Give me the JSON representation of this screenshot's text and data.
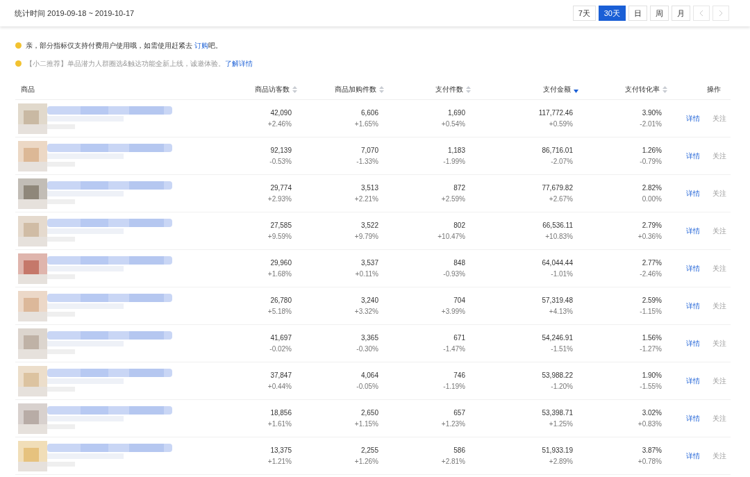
{
  "header": {
    "period": "统计时间 2019-09-18 ~ 2019-10-17",
    "ranges": [
      {
        "label": "7天",
        "selected": false
      },
      {
        "label": "30天",
        "selected": true
      },
      {
        "label": "日",
        "selected": false
      },
      {
        "label": "周",
        "selected": false
      },
      {
        "label": "月",
        "selected": false
      }
    ]
  },
  "notices": [
    {
      "text": "亲，部分指标仅支持付费用户使用哦，如需使用赶紧去 ",
      "link": "订购",
      "after": "吧。",
      "muted": false
    },
    {
      "text": "【小二推荐】单品潜力人群圈选&触达功能全新上线，诚邀体验。",
      "link": "了解详情",
      "muted": true
    }
  ],
  "table": {
    "columns": [
      {
        "label": "商品",
        "sortable": false
      },
      {
        "label": "商品访客数",
        "sortable": true,
        "sorted": false
      },
      {
        "label": "商品加购件数",
        "sortable": true,
        "sorted": false
      },
      {
        "label": "支付件数",
        "sortable": true,
        "sorted": false
      },
      {
        "label": "支付金额",
        "sortable": true,
        "sorted": true
      },
      {
        "label": "支付转化率",
        "sortable": true,
        "sorted": false
      },
      {
        "label": "操作",
        "sortable": false
      }
    ],
    "rows": [
      {
        "cells": [
          {
            "kind": "picture"
          },
          {
            "kind": "metric",
            "value": "42,090",
            "change": "+2.46%"
          },
          {
            "kind": "metric",
            "value": "6,606",
            "change": "+1.65%"
          },
          {
            "kind": "metric",
            "value": "1,690",
            "change": "+0.54%"
          },
          {
            "kind": "metric",
            "value": "117,772.46",
            "change": "+0.59%"
          },
          {
            "kind": "metric",
            "value": "3.90%",
            "change": "-2.01%"
          },
          {
            "kind": "actions",
            "links": [
              "详情",
              "关注"
            ]
          }
        ]
      },
      {
        "cells": [
          {
            "kind": "picture"
          },
          {
            "kind": "metric",
            "value": "92,139",
            "change": "-0.53%"
          },
          {
            "kind": "metric",
            "value": "7,070",
            "change": "-1.33%"
          },
          {
            "kind": "metric",
            "value": "1,183",
            "change": "-1.99%"
          },
          {
            "kind": "metric",
            "value": "86,716.01",
            "change": "-2.07%"
          },
          {
            "kind": "metric",
            "value": "1.26%",
            "change": "-0.79%"
          },
          {
            "kind": "actions",
            "links": [
              "详情",
              "关注"
            ]
          }
        ]
      },
      {
        "cells": [
          {
            "kind": "picture"
          },
          {
            "kind": "metric",
            "value": "29,774",
            "change": "+2.93%"
          },
          {
            "kind": "metric",
            "value": "3,513",
            "change": "+2.21%"
          },
          {
            "kind": "metric",
            "value": "872",
            "change": "+2.59%"
          },
          {
            "kind": "metric",
            "value": "77,679.82",
            "change": "+2.67%"
          },
          {
            "kind": "metric",
            "value": "2.82%",
            "change": "0.00%"
          },
          {
            "kind": "actions",
            "links": [
              "详情",
              "关注"
            ]
          }
        ]
      },
      {
        "cells": [
          {
            "kind": "picture"
          },
          {
            "kind": "metric",
            "value": "27,585",
            "change": "+9.59%"
          },
          {
            "kind": "metric",
            "value": "3,522",
            "change": "+9.79%"
          },
          {
            "kind": "metric",
            "value": "802",
            "change": "+10.47%"
          },
          {
            "kind": "metric",
            "value": "66,536.11",
            "change": "+10.83%"
          },
          {
            "kind": "metric",
            "value": "2.79%",
            "change": "+0.36%"
          },
          {
            "kind": "actions",
            "links": [
              "详情",
              "关注"
            ]
          }
        ]
      },
      {
        "cells": [
          {
            "kind": "picture"
          },
          {
            "kind": "metric",
            "value": "29,960",
            "change": "+1.68%"
          },
          {
            "kind": "metric",
            "value": "3,537",
            "change": "+0.11%"
          },
          {
            "kind": "metric",
            "value": "848",
            "change": "-0.93%"
          },
          {
            "kind": "metric",
            "value": "64,044.44",
            "change": "-1.01%"
          },
          {
            "kind": "metric",
            "value": "2.77%",
            "change": "-2.46%"
          },
          {
            "kind": "actions",
            "links": [
              "详情",
              "关注"
            ]
          }
        ]
      },
      {
        "cells": [
          {
            "kind": "picture"
          },
          {
            "kind": "metric",
            "value": "26,780",
            "change": "+5.18%"
          },
          {
            "kind": "metric",
            "value": "3,240",
            "change": "+3.32%"
          },
          {
            "kind": "metric",
            "value": "704",
            "change": "+3.99%"
          },
          {
            "kind": "metric",
            "value": "57,319.48",
            "change": "+4.13%"
          },
          {
            "kind": "metric",
            "value": "2.59%",
            "change": "-1.15%"
          },
          {
            "kind": "actions",
            "links": [
              "详情",
              "关注"
            ]
          }
        ]
      },
      {
        "cells": [
          {
            "kind": "picture"
          },
          {
            "kind": "metric",
            "value": "41,697",
            "change": "-0.02%"
          },
          {
            "kind": "metric",
            "value": "3,365",
            "change": "-0.30%"
          },
          {
            "kind": "metric",
            "value": "671",
            "change": "-1.47%"
          },
          {
            "kind": "metric",
            "value": "54,246.91",
            "change": "-1.51%"
          },
          {
            "kind": "metric",
            "value": "1.56%",
            "change": "-1.27%"
          },
          {
            "kind": "actions",
            "links": [
              "详情",
              "关注"
            ]
          }
        ]
      },
      {
        "cells": [
          {
            "kind": "picture"
          },
          {
            "kind": "metric",
            "value": "37,847",
            "change": "+0.44%"
          },
          {
            "kind": "metric",
            "value": "4,064",
            "change": "-0.05%"
          },
          {
            "kind": "metric",
            "value": "746",
            "change": "-1.19%"
          },
          {
            "kind": "metric",
            "value": "53,988.22",
            "change": "-1.20%"
          },
          {
            "kind": "metric",
            "value": "1.90%",
            "change": "-1.55%"
          },
          {
            "kind": "actions",
            "links": [
              "详情",
              "关注"
            ]
          }
        ]
      },
      {
        "cells": [
          {
            "kind": "picture"
          },
          {
            "kind": "metric",
            "value": "18,856",
            "change": "+1.61%"
          },
          {
            "kind": "metric",
            "value": "2,650",
            "change": "+1.15%"
          },
          {
            "kind": "metric",
            "value": "657",
            "change": "+1.23%"
          },
          {
            "kind": "metric",
            "value": "53,398.71",
            "change": "+1.25%"
          },
          {
            "kind": "metric",
            "value": "3.02%",
            "change": "+0.83%"
          },
          {
            "kind": "actions",
            "links": [
              "详情",
              "关注"
            ]
          }
        ]
      },
      {
        "cells": [
          {
            "kind": "picture"
          },
          {
            "kind": "metric",
            "value": "13,375",
            "change": "+1.21%"
          },
          {
            "kind": "metric",
            "value": "2,255",
            "change": "+1.26%"
          },
          {
            "kind": "metric",
            "value": "586",
            "change": "+2.81%"
          },
          {
            "kind": "metric",
            "value": "51,933.19",
            "change": "+2.89%"
          },
          {
            "kind": "metric",
            "value": "3.87%",
            "change": "+0.78%"
          },
          {
            "kind": "actions",
            "links": [
              "详情",
              "关注"
            ]
          }
        ]
      }
    ]
  }
}
